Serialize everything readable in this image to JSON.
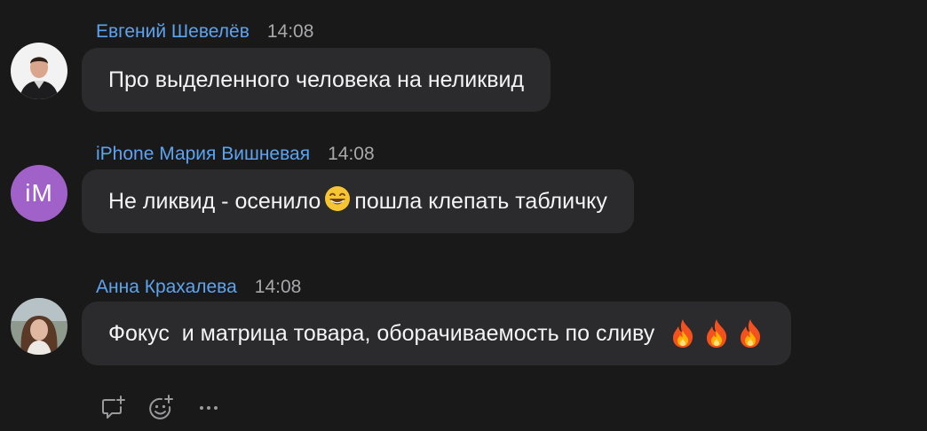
{
  "messages": [
    {
      "author": "Евгений Шевелёв",
      "time": "14:08",
      "text": "Про выделенного человека на неликвид",
      "avatar": {
        "type": "photo",
        "icon": "user-photo"
      }
    },
    {
      "author": "iPhone Мария Вишневая",
      "time": "14:08",
      "text_before": "Не ликвид - осенило",
      "emoji": "grinning-face-emoji",
      "text_after": "пошла клепать табличку",
      "avatar": {
        "type": "initials",
        "initials": "iM",
        "color": "#a061c8"
      }
    },
    {
      "author": "Анна Крахалева",
      "time": "14:08",
      "text": "Фокус  и матрица товара, оборачиваемость по сливу",
      "reactions": [
        "fire-emoji",
        "fire-emoji",
        "fire-emoji"
      ],
      "avatar": {
        "type": "photo",
        "icon": "user-photo"
      }
    }
  ],
  "actions": {
    "reply": "reply-thread-icon",
    "reaction": "add-reaction-icon",
    "more": "more-icon"
  },
  "colors": {
    "background": "#19191a",
    "bubble": "#2b2b2d",
    "author": "#5ea3ee",
    "time": "#a8a8aa"
  }
}
